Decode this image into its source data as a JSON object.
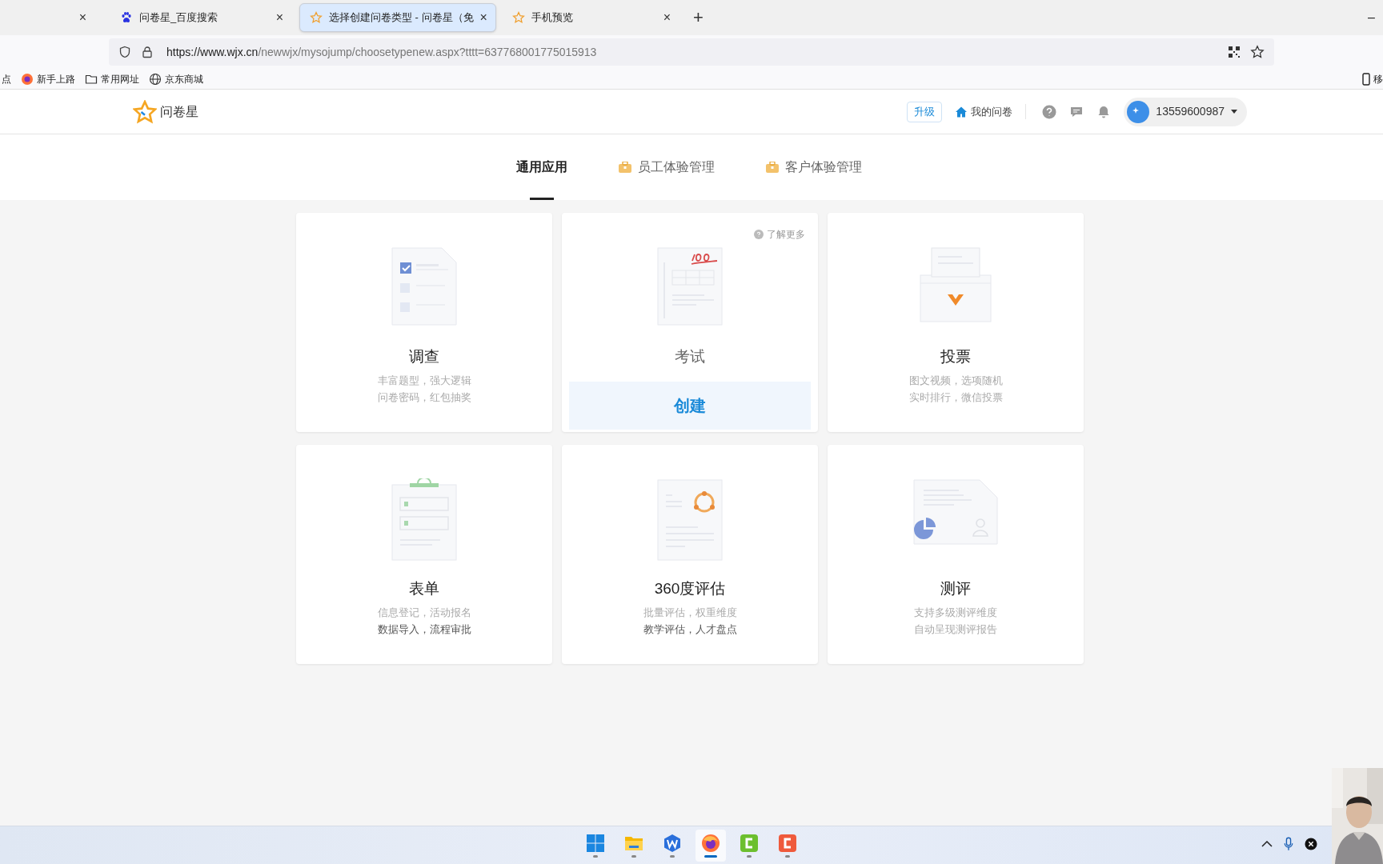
{
  "browser": {
    "tabs": [
      {
        "close": "×",
        "selected": false
      },
      {
        "title": "问卷星_百度搜索",
        "close": "×",
        "selected": false
      },
      {
        "title": "选择创建问卷类型 - 问卷星（免",
        "close": "×",
        "selected": true
      },
      {
        "title": "手机预览",
        "close": "×",
        "selected": false
      }
    ],
    "new_tab": "+",
    "minimize": "–",
    "url_host": "https://www.wjx.cn",
    "url_path": "/newwjx/mysojump/choosetypenew.aspx?tttt=637768001775015913",
    "bookmarks": [
      {
        "label": "点"
      },
      {
        "label": "新手上路"
      },
      {
        "label": "常用网址"
      },
      {
        "label": "京东商城"
      }
    ],
    "mobile_bookmarks": "移"
  },
  "header": {
    "logo": "问卷星",
    "upgrade": "升级",
    "my_surveys": "我的问卷",
    "user": "13559600987"
  },
  "nav": [
    {
      "label": "通用应用",
      "badge": false,
      "selected": true
    },
    {
      "label": "员工体验管理",
      "badge": true,
      "selected": false
    },
    {
      "label": "客户体验管理",
      "badge": true,
      "selected": false
    }
  ],
  "cards": [
    {
      "kind": "survey",
      "title": "调查",
      "lines": [
        {
          "text": "丰富题型，强大逻辑",
          "dark": false
        },
        {
          "text": "问卷密码，红包抽奖",
          "dark": false
        }
      ],
      "hovered": false
    },
    {
      "kind": "exam",
      "title": "考试",
      "hovered": true,
      "learn_more": "了解更多",
      "create": "创建"
    },
    {
      "kind": "vote",
      "title": "投票",
      "lines": [
        {
          "text": "图文视频，选项随机",
          "dark": false
        },
        {
          "text": "实时排行，微信投票",
          "dark": false
        }
      ],
      "hovered": false
    },
    {
      "kind": "form",
      "title": "表单",
      "lines": [
        {
          "text": "信息登记，活动报名",
          "dark": false
        },
        {
          "text": "数据导入，流程审批",
          "dark": true
        }
      ],
      "hovered": false
    },
    {
      "kind": "review",
      "title": "360度评估",
      "lines": [
        {
          "text": "批量评估，权重维度",
          "dark": false
        },
        {
          "text": "教学评估，人才盘点",
          "dark": true
        }
      ],
      "hovered": false
    },
    {
      "kind": "assess",
      "title": "测评",
      "lines": [
        {
          "text": "支持多级测评维度",
          "dark": false
        },
        {
          "text": "自动呈现测评报告",
          "dark": false
        }
      ],
      "hovered": false
    }
  ],
  "taskbar": {
    "apps": [
      {
        "kind": "start",
        "selected": false
      },
      {
        "kind": "folder",
        "selected": false
      },
      {
        "kind": "wps",
        "selected": false
      },
      {
        "kind": "firefox",
        "selected": true
      },
      {
        "kind": "green",
        "selected": false
      },
      {
        "kind": "red",
        "selected": false
      }
    ]
  }
}
